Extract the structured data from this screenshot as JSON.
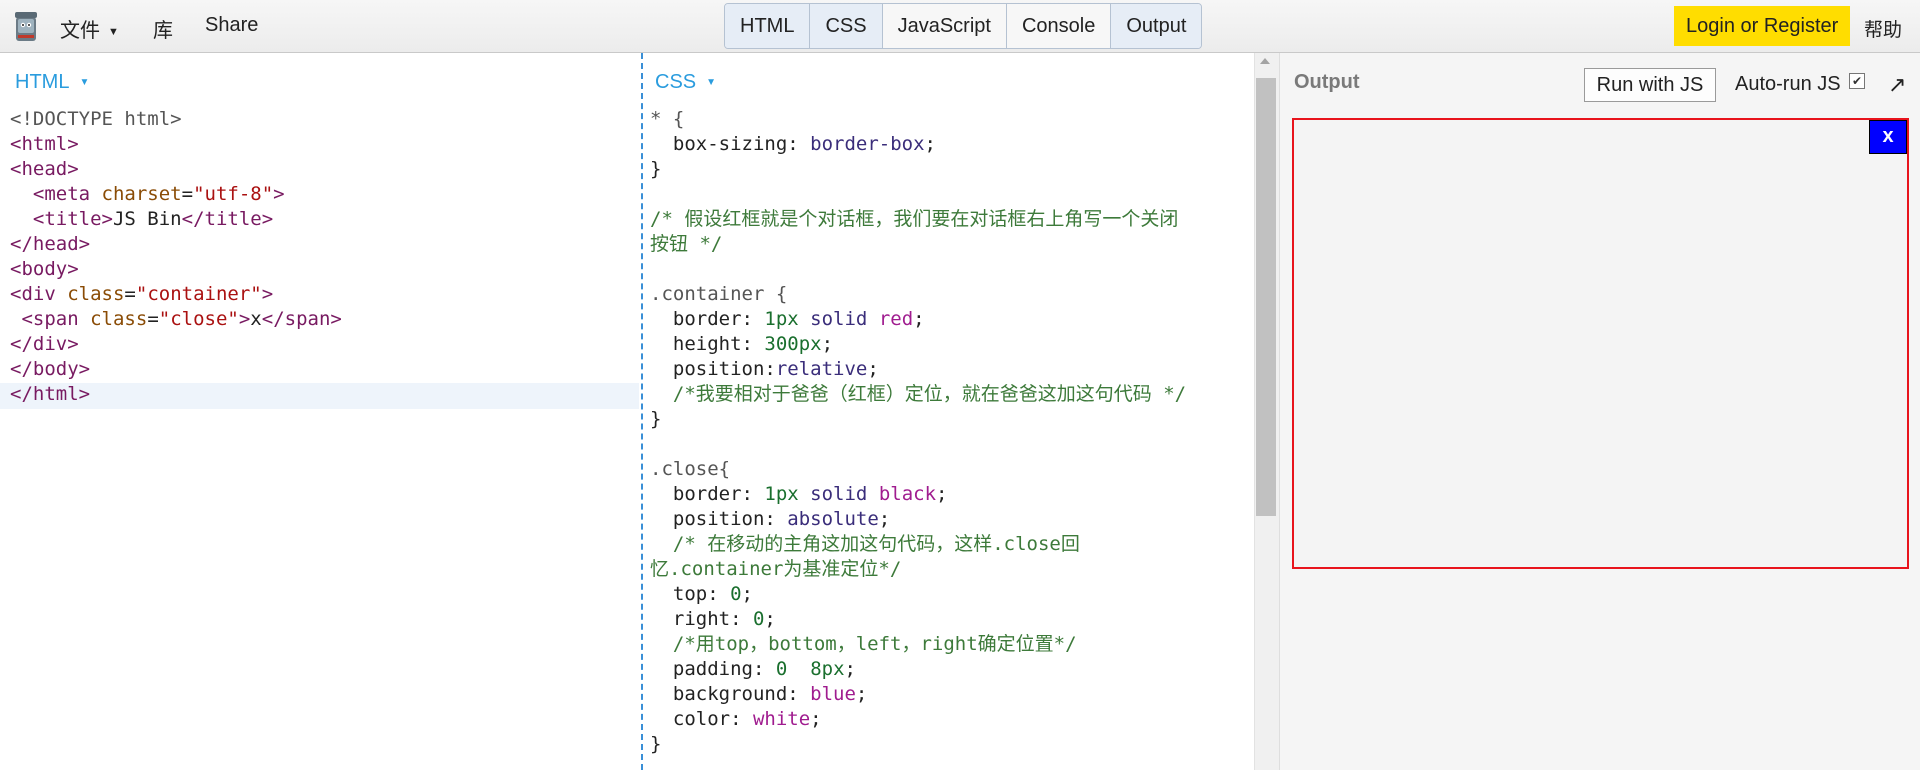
{
  "topbar": {
    "menu_file": "文件",
    "menu_library": "库",
    "menu_share": "Share",
    "tabs": [
      "HTML",
      "CSS",
      "JavaScript",
      "Console",
      "Output"
    ],
    "login": "Login or Register",
    "help": "帮助"
  },
  "panels": {
    "html_label": "HTML",
    "css_label": "CSS",
    "output_label": "Output",
    "run_button": "Run with JS",
    "autorun_label": "Auto-run JS",
    "autorun_checked": true,
    "popout_icon": "↗"
  },
  "preview": {
    "close_text": "x"
  },
  "html_code": [
    "<!DOCTYPE html>",
    "<html>",
    "<head>",
    "  <meta charset=\"utf-8\">",
    "  <title>JS Bin</title>",
    "</head>",
    "<body>",
    "<div class=\"container\">",
    " <span class=\"close\">x</span>",
    "</div>",
    "</body>",
    "</html>"
  ],
  "css_code": [
    "* {",
    "  box-sizing: border-box;",
    "}",
    "",
    "/* 假设红框就是个对话框，我们要在对话框右上角写一个关闭",
    "按钮 */",
    "",
    ".container {",
    "  border: 1px solid red;",
    "  height: 300px;",
    "  position:relative;",
    "  /*我要相对于爸爸（红框）定位，就在爸爸这加这句代码 */",
    "}",
    "",
    ".close{",
    "  border: 1px solid black;",
    "  position: absolute;",
    "  /* 在移动的主角这加这句代码，这样.close回",
    "忆.container为基准定位*/",
    "  top: 0;",
    "  right: 0;",
    "  /*用top，bottom，left，right确定位置*/",
    "  padding: 0  8px;",
    "  background: blue;",
    "  color: white;",
    "}"
  ],
  "colors": {
    "accent_blue": "#2a9cde",
    "login_yellow": "#ffdd00",
    "preview_border": "#e8141c",
    "close_bg": "#0000ff"
  }
}
